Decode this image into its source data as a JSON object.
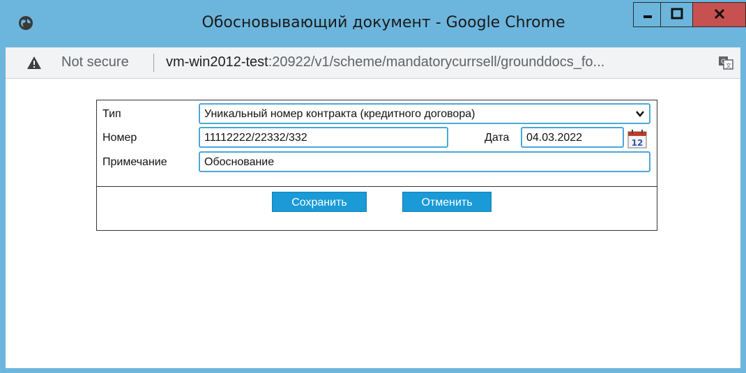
{
  "window": {
    "title": "Обосновывающий документ - Google Chrome",
    "minimize_label": "minimize",
    "maximize_label": "maximize",
    "close_label": "close"
  },
  "addressbar": {
    "security_text": "Not secure",
    "url_host": "vm-win2012-test",
    "url_rest": ":20922/v1/scheme/mandatorycurrsell/grounddocs_fo..."
  },
  "form": {
    "type_label": "Тип",
    "type_value": "Уникальный номер контракта (кредитного договора)",
    "number_label": "Номер",
    "number_value": "11112222/22332/332",
    "date_label": "Дата",
    "date_value": "04.03.2022",
    "note_label": "Примечание",
    "note_value": "Обоснование",
    "save_label": "Сохранить",
    "cancel_label": "Отменить"
  },
  "colors": {
    "titlebar": "#6cb6dd",
    "close_button": "#c75050",
    "field_border": "#4aa8d8",
    "action_button": "#1a9ad6"
  },
  "icons": [
    "globe-icon",
    "warning-icon",
    "translate-icon",
    "chevron-down-icon",
    "calendar-icon"
  ]
}
